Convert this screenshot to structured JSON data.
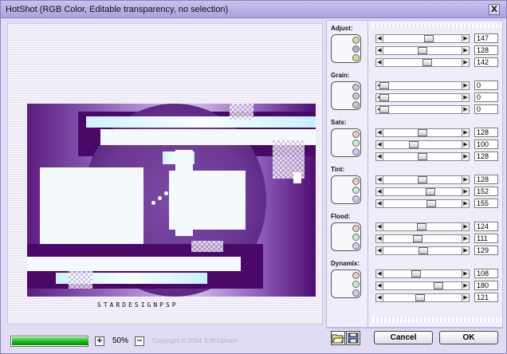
{
  "window": {
    "title": "HotShot (RGB Color, Editable transparency, no selection)",
    "close_label": "X"
  },
  "preview": {
    "wordmark": "STARDESIGNPSP"
  },
  "footer": {
    "progress": 1.0,
    "zoom_in_label": "+",
    "zoom_level": "50%",
    "zoom_out_label": "−",
    "copyright": "Copyright © 2004 S.W.Upham"
  },
  "groups": [
    {
      "label": "Adjust:",
      "dots": [
        "#d8d890",
        "#b4b4b4",
        "#d8d890"
      ],
      "sliders": [
        {
          "value": "147",
          "position": 0.58
        },
        {
          "value": "128",
          "position": 0.5
        },
        {
          "value": "142",
          "position": 0.56
        }
      ]
    },
    {
      "label": "Grain:",
      "dots": [
        "#c8c8c8",
        "#c8c8c8",
        "#c8c8c8"
      ],
      "sliders": [
        {
          "value": "0",
          "position": 0.0
        },
        {
          "value": "0",
          "position": 0.0
        },
        {
          "value": "0",
          "position": 0.0
        }
      ]
    },
    {
      "label": "Sats:",
      "dots": [
        "#f1c6c6",
        "#c9eec9",
        "#c9cff1"
      ],
      "sliders": [
        {
          "value": "128",
          "position": 0.5
        },
        {
          "value": "100",
          "position": 0.39
        },
        {
          "value": "128",
          "position": 0.5
        }
      ]
    },
    {
      "label": "Tint:",
      "dots": [
        "#f1c6c6",
        "#c9eec9",
        "#c9cff1"
      ],
      "sliders": [
        {
          "value": "128",
          "position": 0.5
        },
        {
          "value": "152",
          "position": 0.6
        },
        {
          "value": "155",
          "position": 0.61
        }
      ]
    },
    {
      "label": "Flood:",
      "dots": [
        "#f1c6c6",
        "#c9eec9",
        "#c9cff1"
      ],
      "sliders": [
        {
          "value": "124",
          "position": 0.49
        },
        {
          "value": "111",
          "position": 0.44
        },
        {
          "value": "129",
          "position": 0.51
        }
      ]
    },
    {
      "label": "Dynamix:",
      "dots": [
        "#f1c6c6",
        "#c9eec9",
        "#c9cff1"
      ],
      "sliders": [
        {
          "value": "108",
          "position": 0.42
        },
        {
          "value": "180",
          "position": 0.71
        },
        {
          "value": "121",
          "position": 0.47
        }
      ]
    }
  ],
  "buttons": {
    "cancel": "Cancel",
    "ok": "OK"
  },
  "icons": {
    "open": "folder-open-icon",
    "save": "save-disk-icon"
  }
}
